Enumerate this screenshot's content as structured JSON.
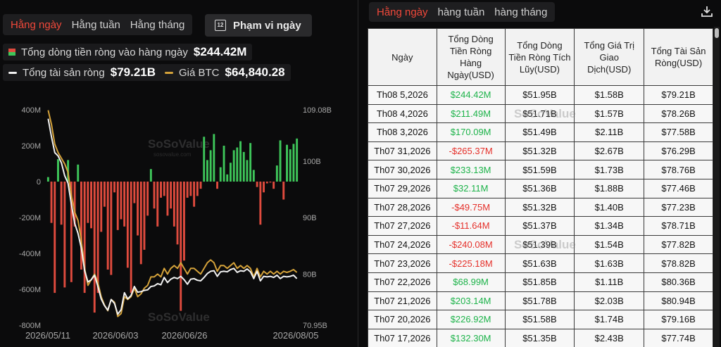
{
  "left_panel": {
    "tabs": [
      "Hằng ngày",
      "Hằng tuần",
      "Hằng tháng"
    ],
    "active_tab": 0,
    "range_button": "Phạm vi ngày",
    "calendar_glyph": "12",
    "legend": {
      "inflow_label": "Tổng dòng tiền ròng vào hàng ngày",
      "inflow_value": "$244.42M",
      "net_assets_label": "Tổng tài sản ròng",
      "net_assets_value": "$79.21B",
      "btc_label": "Giá BTC",
      "btc_value": "$64,840.28"
    },
    "watermark": "SoSoValue",
    "watermark_sub": "sosovalue.com"
  },
  "colors": {
    "positive": "#3ec65a",
    "negative": "#e04b3e",
    "net_assets_line": "#f2f2f2",
    "btc_line": "#d4a23a",
    "active_tab": "#f0483a"
  },
  "chart_data": {
    "type": "bar",
    "x_tick_labels": [
      "2026/05/11",
      "2026/06/03",
      "2026/06/26",
      "2026/08/05"
    ],
    "left_axis": {
      "ticks": [
        "400M",
        "200M",
        "0",
        "-200M",
        "-400M",
        "-600M",
        "-800M"
      ],
      "ylim": [
        -800,
        400
      ],
      "unit": "M"
    },
    "right_axis": {
      "ticks": [
        "109.08B",
        "100B",
        "90B",
        "80B",
        "70.95B"
      ],
      "ylim": [
        70.95,
        109.08
      ],
      "unit": "B"
    },
    "series": [
      {
        "name": "Tổng dòng tiền ròng vào hàng ngày",
        "values": [
          25,
          -230,
          -620,
          125,
          -240,
          -590,
          120,
          -560,
          -250,
          95,
          -490,
          -620,
          -230,
          -260,
          -730,
          -620,
          -280,
          -140,
          -490,
          -520,
          -60,
          -270,
          -210,
          -250,
          -480,
          -620,
          -120,
          -300,
          -460,
          -380,
          -190,
          70,
          -150,
          -250,
          -90,
          -80,
          -190,
          -150,
          -250,
          -350,
          -720,
          -440,
          -90,
          -80,
          -140,
          -80,
          -40,
          250,
          120,
          175,
          265,
          -40,
          80,
          200,
          40,
          105,
          175,
          190,
          225,
          165,
          120,
          215,
          65,
          -30,
          -240,
          -60,
          -10,
          -5,
          -40,
          90,
          230,
          -100,
          205,
          180,
          210,
          240
        ]
      },
      {
        "name": "Tổng tài sản ròng",
        "values": [
          107.5,
          104.3,
          101.5,
          100.9,
          99.7,
          97.4,
          96.1,
          92.4,
          89.0,
          87.2,
          84.6,
          80.6,
          78.6,
          79.0,
          79.8,
          77.8,
          75.6,
          74.4,
          73.6,
          75.5,
          74.8,
          72.9,
          73.7,
          76.7,
          75.6,
          76.2,
          77.8,
          76.8,
          76.9,
          77.1,
          77.2,
          77.8,
          77.9,
          78.3,
          78.1,
          79.4,
          78.5,
          79.1,
          79.4,
          79.2,
          79.6,
          79.0,
          78.2,
          79.1,
          79.2,
          78.9,
          78.8,
          79.4,
          80.1,
          80.5,
          80.6,
          79.6,
          80.4,
          80.5,
          80.4,
          80.8,
          81.0,
          80.3,
          80.6,
          80.5,
          80.9,
          80.4,
          79.2,
          80.5,
          78.8,
          79.6,
          79.5,
          79.6,
          79.4,
          79.8,
          79.2,
          79.6,
          79.5,
          79.6,
          79.8,
          79.2
        ]
      },
      {
        "name": "Giá BTC",
        "values": [
          109.0,
          106.5,
          103.0,
          101.5,
          100.5,
          99.5,
          98.0,
          94.0,
          91.0,
          89.5,
          86.0,
          81.0,
          78.0,
          79.0,
          80.0,
          78.5,
          76.0,
          74.5,
          73.5,
          75.5,
          75.0,
          72.5,
          73.0,
          76.0,
          75.5,
          76.0,
          77.5,
          76.0,
          76.5,
          77.5,
          78.0,
          79.5,
          79.5,
          80.0,
          79.5,
          81.0,
          80.0,
          81.0,
          81.5,
          81.0,
          82.0,
          81.0,
          80.0,
          81.0,
          81.0,
          80.5,
          80.0,
          81.0,
          82.0,
          82.5,
          82.0,
          80.5,
          81.5,
          81.5,
          81.0,
          81.5,
          82.0,
          81.0,
          81.5,
          81.0,
          81.5,
          81.0,
          79.5,
          81.0,
          79.5,
          80.5,
          80.0,
          80.5,
          80.0,
          80.5,
          80.0,
          80.5,
          80.3,
          80.5,
          80.8,
          80.3
        ]
      }
    ]
  },
  "right_panel": {
    "tabs": [
      "Hằng ngày",
      "hàng tuần",
      "hàng tháng"
    ],
    "active_tab": 0,
    "download_icon": "download-icon",
    "columns": [
      "Ngày",
      "Tổng Dòng Tiền Ròng Hàng Ngày(USD)",
      "Tổng Dòng Tiền Ròng Tích Lũy(USD)",
      "Tổng Giá Trị Giao Dịch(USD)",
      "Tổng Tài Sản Ròng(USD)"
    ],
    "rows": [
      [
        "Th08 5,2026",
        "$244.42M",
        "$51.95B",
        "$1.58B",
        "$79.21B"
      ],
      [
        "Th08 4,2026",
        "$211.49M",
        "$51.71B",
        "$1.57B",
        "$78.26B"
      ],
      [
        "Th08 3,2026",
        "$170.09M",
        "$51.49B",
        "$2.11B",
        "$77.58B"
      ],
      [
        "Th07 31,2026",
        "-$265.37M",
        "$51.32B",
        "$2.67B",
        "$76.29B"
      ],
      [
        "Th07 30,2026",
        "$233.13M",
        "$51.59B",
        "$1.73B",
        "$78.76B"
      ],
      [
        "Th07 29,2026",
        "$32.11M",
        "$51.36B",
        "$1.88B",
        "$77.46B"
      ],
      [
        "Th07 28,2026",
        "-$49.75M",
        "$51.32B",
        "$1.40B",
        "$77.23B"
      ],
      [
        "Th07 27,2026",
        "-$11.64M",
        "$51.37B",
        "$1.34B",
        "$78.71B"
      ],
      [
        "Th07 24,2026",
        "-$240.08M",
        "$51.39B",
        "$1.54B",
        "$77.82B"
      ],
      [
        "Th07 23,2026",
        "-$225.18M",
        "$51.63B",
        "$1.63B",
        "$78.82B"
      ],
      [
        "Th07 22,2026",
        "$68.99M",
        "$51.85B",
        "$1.11B",
        "$80.36B"
      ],
      [
        "Th07 21,2026",
        "$203.14M",
        "$51.78B",
        "$2.03B",
        "$80.94B"
      ],
      [
        "Th07 20,2026",
        "$226.92M",
        "$51.58B",
        "$1.74B",
        "$79.16B"
      ],
      [
        "Th07 17,2026",
        "$132.30M",
        "$51.35B",
        "$2.43B",
        "$77.74B"
      ]
    ]
  }
}
